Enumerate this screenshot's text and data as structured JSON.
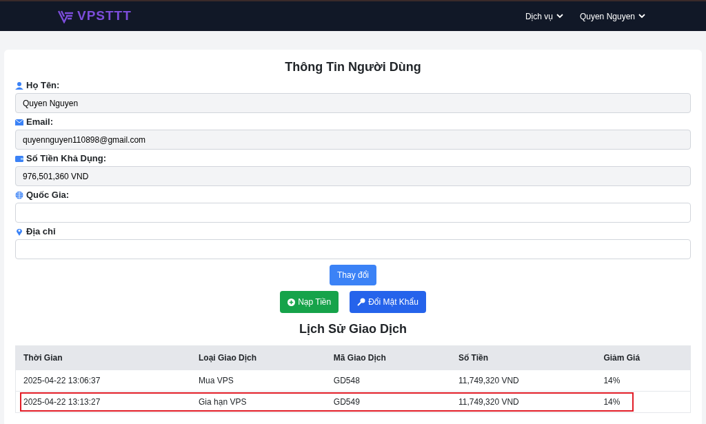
{
  "navbar": {
    "logo": "VPSTTT",
    "menus": [
      {
        "label": "Dịch vụ"
      },
      {
        "label": "Quyen Nguyen"
      }
    ]
  },
  "profile": {
    "title": "Thông Tin Người Dùng",
    "fields": [
      {
        "label": "Họ Tên:",
        "value": "Quyen Nguyen",
        "readonly": true
      },
      {
        "label": "Email:",
        "value": "quyennguyen110898@gmail.com",
        "readonly": true
      },
      {
        "label": "Số Tiền Khả Dụng:",
        "value": "976,501,360 VND",
        "readonly": true
      },
      {
        "label": "Quốc Gia:",
        "readonly": false
      },
      {
        "label": "Địa chỉ",
        "readonly": false
      }
    ],
    "save_button": "Thay đổi",
    "actions": [
      {
        "label": "Nạp Tiền",
        "kind": "success"
      },
      {
        "label": "Đổi Mật Khẩu",
        "kind": "primary"
      }
    ]
  },
  "history": {
    "title": "Lịch Sử Giao Dịch",
    "columns": [
      "Thời Gian",
      "Loại Giao Dịch",
      "Mã Giao Dịch",
      "Số Tiền",
      "Giảm Giá"
    ],
    "rows": [
      {
        "cells": [
          "2025-04-22 13:06:37",
          "Mua VPS",
          "GD548",
          "11,749,320 VND",
          "14%"
        ],
        "highlighted": false
      },
      {
        "cells": [
          "2025-04-22 13:13:27",
          "Gia hạn VPS",
          "GD549",
          "11,749,320 VND",
          "14%"
        ],
        "highlighted": true
      }
    ]
  }
}
